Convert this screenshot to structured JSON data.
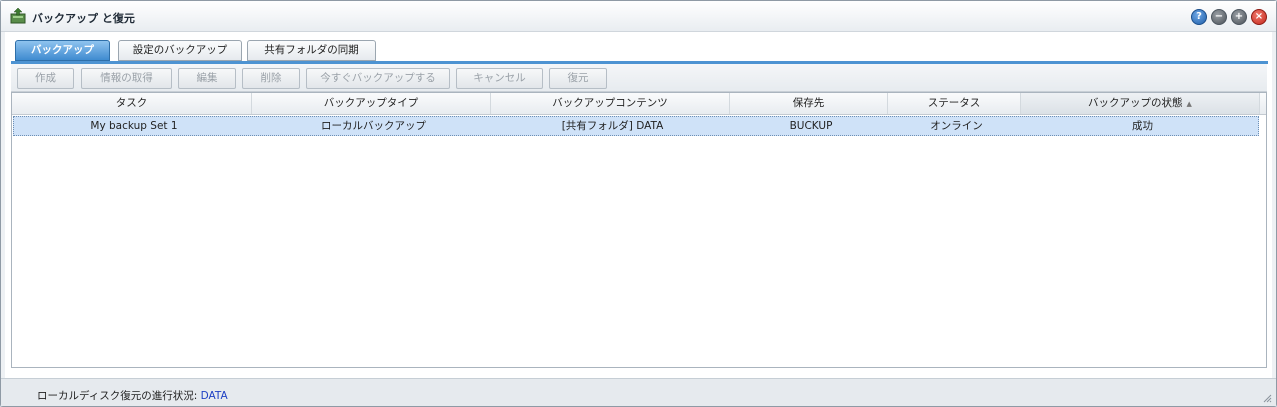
{
  "window": {
    "title": "バックアップ と復元",
    "buttons": {
      "help": "?",
      "minimize": "−",
      "maximize": "+",
      "close": "×"
    }
  },
  "tabs": [
    {
      "label": "バックアップ",
      "active": true
    },
    {
      "label": "設定のバックアップ",
      "active": false
    },
    {
      "label": "共有フォルダの同期",
      "active": false
    }
  ],
  "toolbar": {
    "buttons": [
      {
        "label": "作成"
      },
      {
        "label": "情報の取得"
      },
      {
        "label": "編集"
      },
      {
        "label": "削除"
      },
      {
        "label": "今すぐバックアップする"
      },
      {
        "label": "キャンセル"
      },
      {
        "label": "復元"
      }
    ]
  },
  "table": {
    "columns": [
      "タスク",
      "バックアップタイプ",
      "バックアップコンテンツ",
      "保存先",
      "ステータス",
      "バックアップの状態"
    ],
    "sorted_indicator": "▲",
    "rows": [
      [
        "My backup Set 1",
        "ローカルバックアップ",
        "[共有フォルダ] DATA",
        "BUCKUP",
        "オンライン",
        "成功"
      ]
    ]
  },
  "footer": {
    "label": "ローカルディスク復元の進行状況:",
    "value": "DATA"
  },
  "colors": {
    "accent": "#4d93d2",
    "selected_row": "#cfe2f8",
    "status_value": "#1d3fc4"
  }
}
